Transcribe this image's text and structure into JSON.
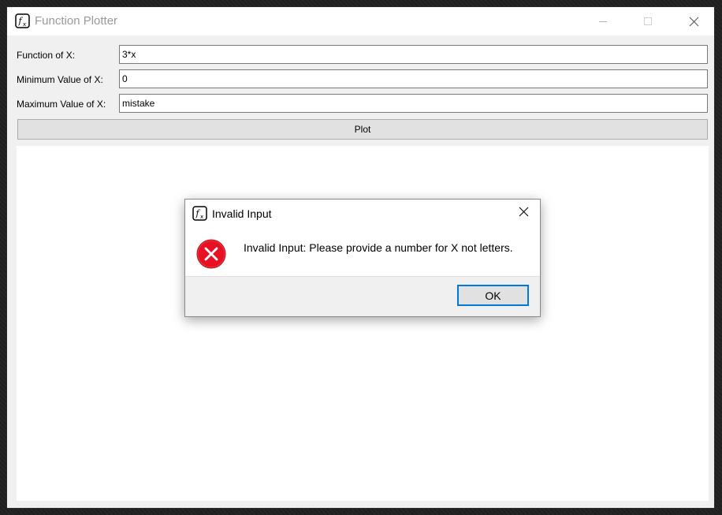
{
  "window": {
    "title": "Function Plotter"
  },
  "form": {
    "function_label": "Function of X:",
    "function_value": "3*x",
    "min_label": "Minimum Value of X:",
    "min_value": "0",
    "max_label": "Maximum Value of X:",
    "max_value": "mistake",
    "plot_label": "Plot"
  },
  "dialog": {
    "title": "Invalid Input",
    "message": "Invalid Input: Please provide a number for X not letters.",
    "ok_label": "OK"
  },
  "icons": {
    "app": "function-fx-icon",
    "minimize": "minimize-icon",
    "maximize": "maximize-icon",
    "close": "close-icon",
    "error": "error-icon"
  },
  "colors": {
    "error_red": "#e81123",
    "focus_blue": "#0078d7",
    "title_inactive": "#999999"
  }
}
